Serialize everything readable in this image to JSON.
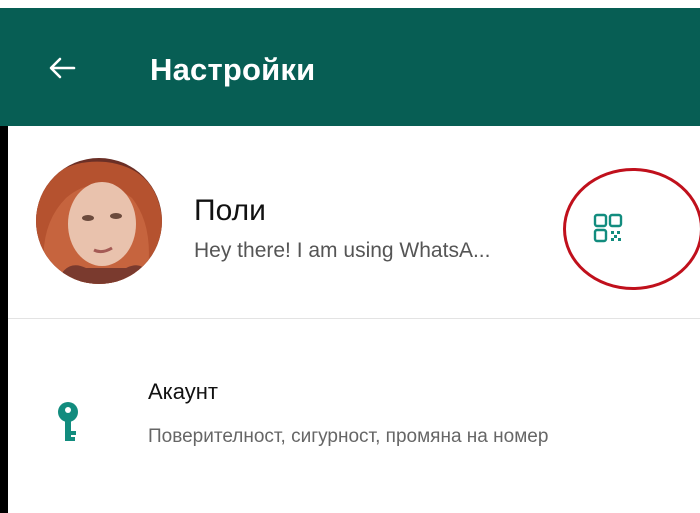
{
  "colors": {
    "appbar": "#075e54",
    "accent_icon": "#128c7e",
    "highlight": "#c0101c"
  },
  "appbar": {
    "back_icon": "arrow-left-icon",
    "title": "Настройки"
  },
  "profile": {
    "name": "Поли",
    "status": "Hey there! I am using WhatsA...",
    "qr_icon": "qr-code-icon"
  },
  "settings": {
    "account": {
      "icon": "key-icon",
      "title": "Акаунт",
      "subtitle": "Поверителност, сигурност, промяна на номер"
    }
  }
}
